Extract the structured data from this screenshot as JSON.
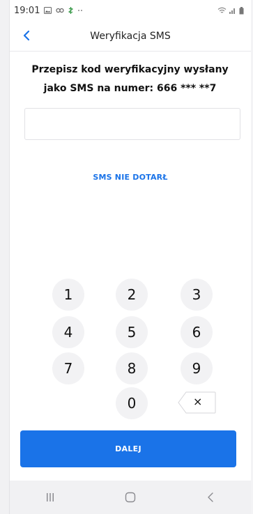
{
  "status_bar": {
    "time": "19:01",
    "left_icons": [
      "gallery-icon",
      "link-icon",
      "notification-icon",
      "more-dots-icon"
    ],
    "right_icons": [
      "wifi-icon",
      "signal-icon",
      "battery-icon"
    ]
  },
  "header": {
    "title": "Weryfikacja SMS",
    "back_icon": "chevron-left-icon"
  },
  "instruction": {
    "line1": "Przepisz kod weryfikacyjny wysłany",
    "line2": "jako SMS na numer: 666 *** **7"
  },
  "code_input": {
    "value": "",
    "placeholder": ""
  },
  "resend_link": "SMS NIE DOTARŁ",
  "keypad": {
    "k1": "1",
    "k2": "2",
    "k3": "3",
    "k4": "4",
    "k5": "5",
    "k6": "6",
    "k7": "7",
    "k8": "8",
    "k9": "9",
    "k0": "0",
    "backspace": "×"
  },
  "next_button": "DALEJ",
  "nav_bar": [
    "recent-apps-icon",
    "home-icon",
    "back-icon"
  ],
  "colors": {
    "accent": "#1a73e8",
    "key_bg": "#f2f2f4",
    "nav_bg": "#f1f1f3"
  }
}
